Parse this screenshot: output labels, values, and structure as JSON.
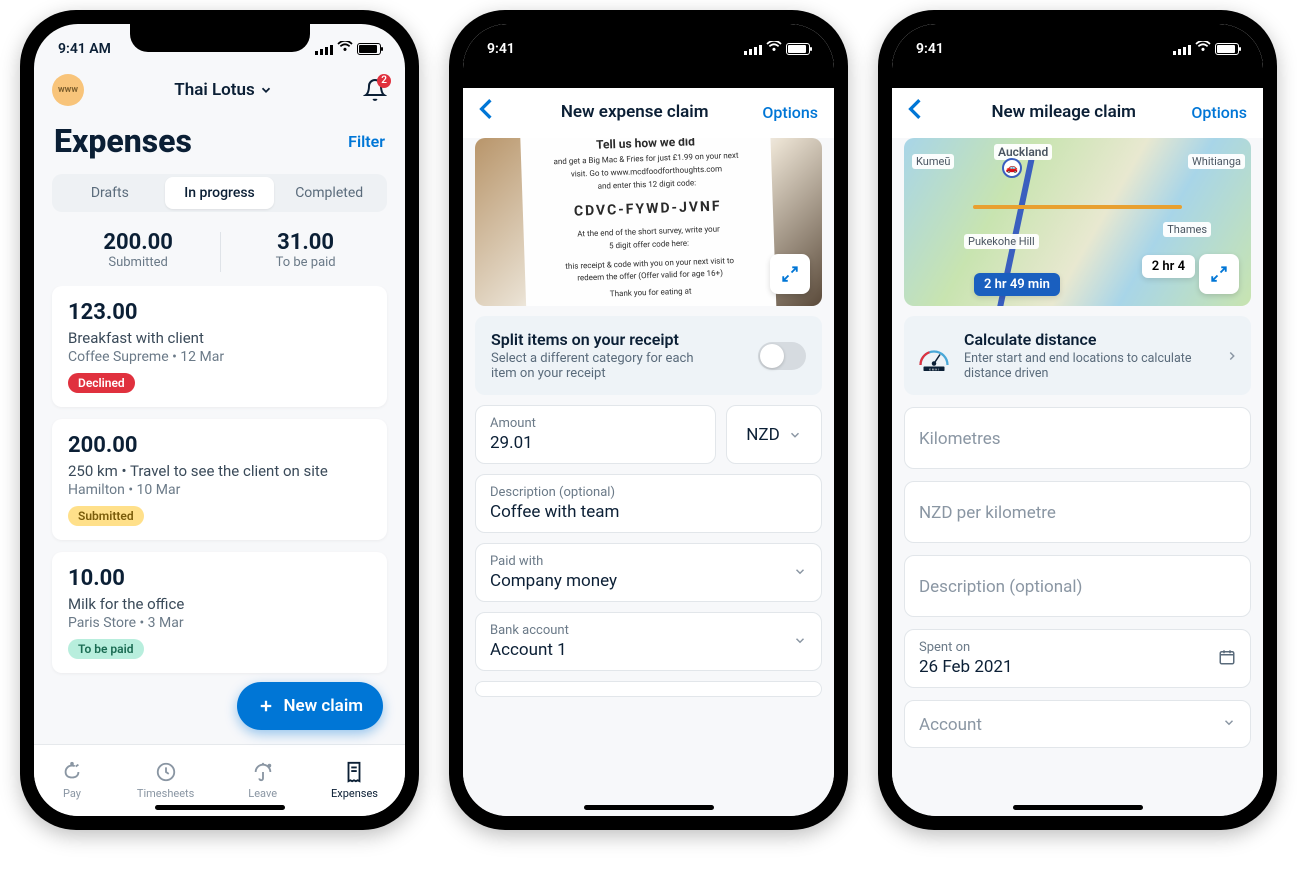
{
  "statusBar": {
    "time1": "9:41 AM",
    "time2": "9:41",
    "time3": "9:41"
  },
  "screen1": {
    "avatarText": "www",
    "orgName": "Thai Lotus",
    "notifCount": "2",
    "pageTitle": "Expenses",
    "filterLabel": "Filter",
    "tabs": {
      "drafts": "Drafts",
      "inProgress": "In progress",
      "completed": "Completed"
    },
    "summary": {
      "submittedValue": "200.00",
      "submittedLabel": "Submitted",
      "toBePaidValue": "31.00",
      "toBePaidLabel": "To be paid"
    },
    "items": [
      {
        "amount": "123.00",
        "desc": "Breakfast with client",
        "meta": "Coffee Supreme • 12 Mar",
        "status": "Declined"
      },
      {
        "amount": "200.00",
        "desc": "250 km • Travel to see the client on site",
        "meta": "Hamilton • 10 Mar",
        "status": "Submitted"
      },
      {
        "amount": "10.00",
        "desc": "Milk for the office",
        "meta": "Paris Store • 3 Mar",
        "status": "To be paid"
      }
    ],
    "fabLabel": "New claim",
    "nav": {
      "pay": "Pay",
      "timesheets": "Timesheets",
      "leave": "Leave",
      "expenses": "Expenses"
    }
  },
  "screen2": {
    "title": "New expense claim",
    "options": "Options",
    "receiptLines": {
      "l1": "Tell us how we did",
      "l2": "and get a Big Mac & Fries for just £1.99 on your next",
      "l3": "visit. Go to www.mcdfoodforthoughts.com",
      "l4": "and enter this 12 digit code:",
      "code": "CDVC-FYWD-JVNF",
      "l5": "At the end of the short survey, write your",
      "l6": "5 digit offer code here:",
      "l7": "this receipt & code with you on your next visit to",
      "l8": "redeem the offer (Offer valid for age 16+)",
      "l9": "Thank you for eating at"
    },
    "split": {
      "heading": "Split items on your receipt",
      "sub": "Select a different category for each item on your receipt"
    },
    "amountLabel": "Amount",
    "amountValue": "29.01",
    "currency": "NZD",
    "descLabel": "Description (optional)",
    "descValue": "Coffee with team",
    "paidLabel": "Paid with",
    "paidValue": "Company money",
    "bankLabel": "Bank account",
    "bankValue": "Account 1"
  },
  "screen3": {
    "title": "New mileage claim",
    "options": "Options",
    "mapLabels": {
      "kumeu": "Kumeū",
      "auckland": "Auckland",
      "whitianga": "Whitianga",
      "pukekohe": "Pukekohe Hill",
      "thames": "Thames"
    },
    "route1": "2 hr 49 min",
    "route2": "2 hr 4",
    "calc": {
      "heading": "Calculate distance",
      "sub": "Enter start and end locations to calculate distance driven"
    },
    "kmPlaceholder": "Kilometres",
    "ratePlaceholder": "NZD per kilometre",
    "descPlaceholder": "Description (optional)",
    "spentLabel": "Spent on",
    "spentValue": "26 Feb 2021",
    "accountLabel": "Account"
  }
}
